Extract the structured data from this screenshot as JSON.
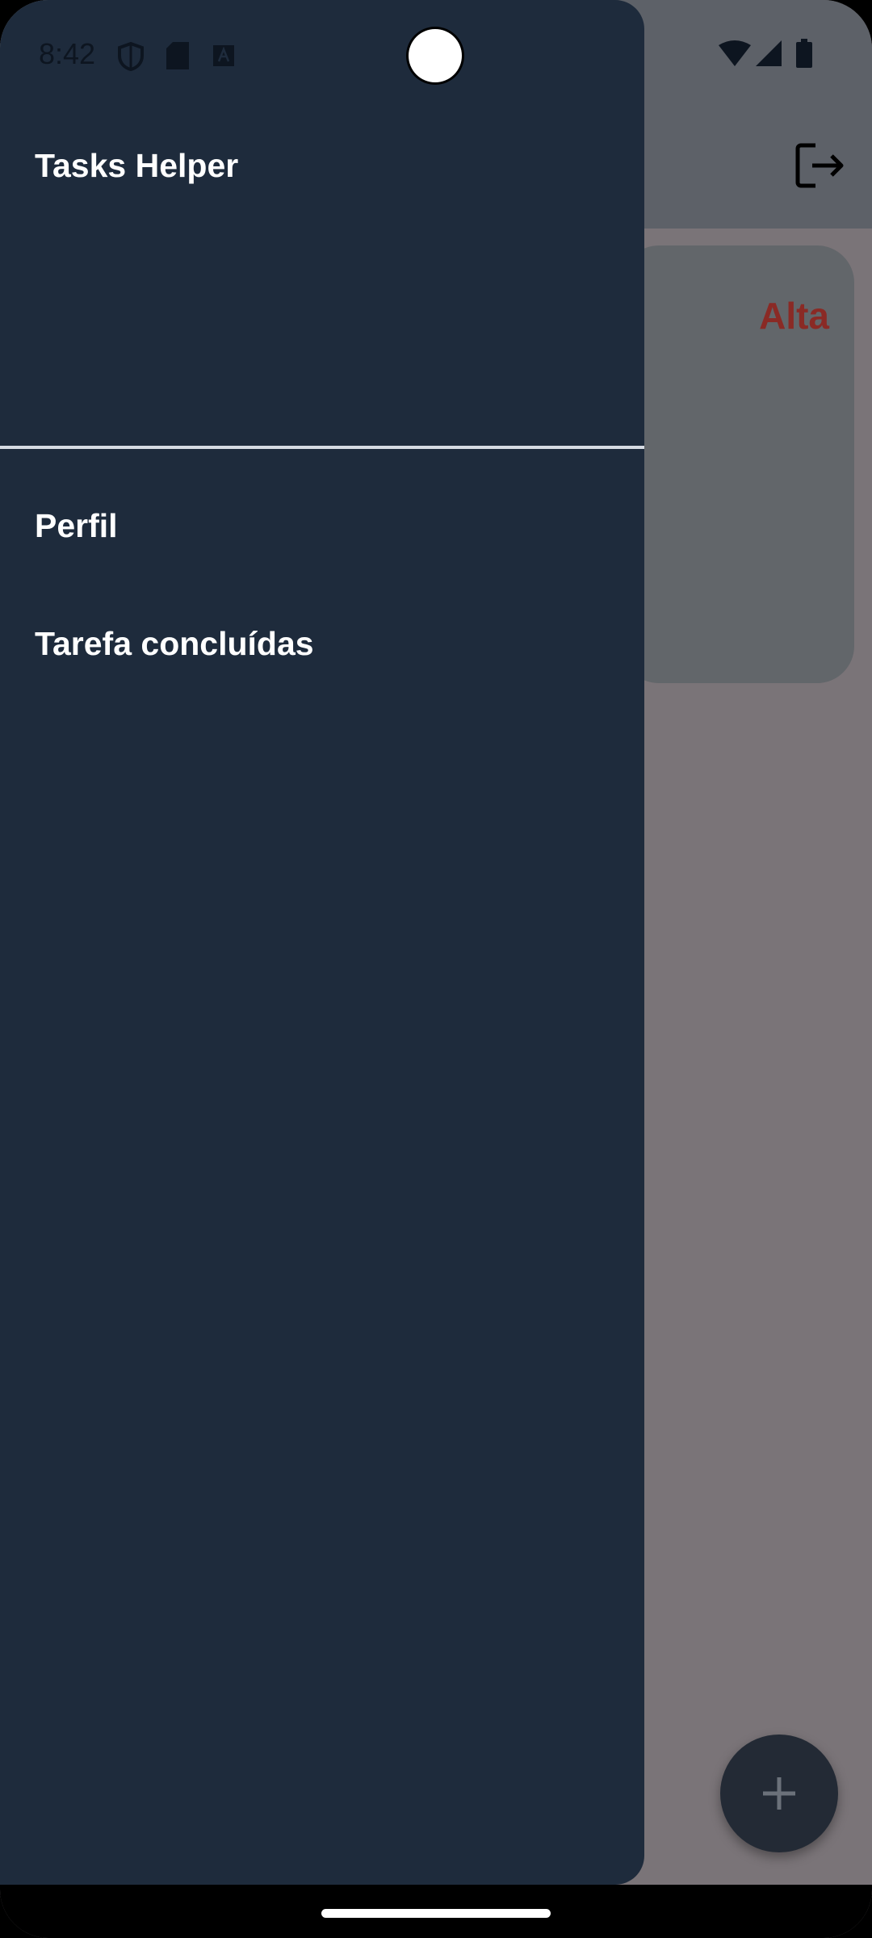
{
  "status_bar": {
    "time": "8:42"
  },
  "drawer": {
    "title": "Tasks Helper",
    "items": [
      {
        "label": "Perfil"
      },
      {
        "label": "Tarefa concluídas"
      }
    ]
  },
  "app": {
    "task_card": {
      "priority": "Alta",
      "priority_color": "#8a2a25"
    },
    "fab_icon": "plus-icon",
    "logout_icon": "logout-icon"
  },
  "colors": {
    "drawer_bg": "#1e2b3c",
    "scrim": "#7a7478"
  }
}
